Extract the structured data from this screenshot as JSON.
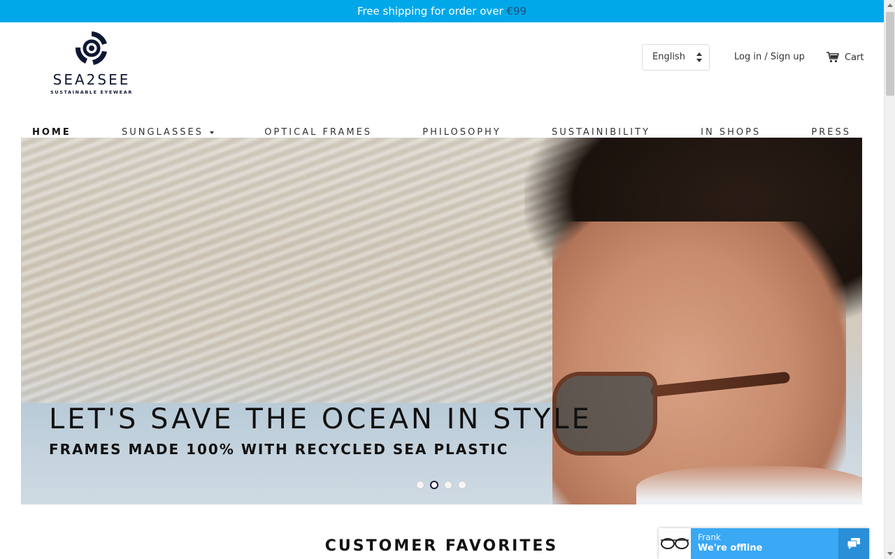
{
  "announcement": {
    "text": "Free shipping for order over ",
    "amount": "€99",
    "background_color": "#00a8ea"
  },
  "header": {
    "logo": {
      "wordmark": "SEA2SEE",
      "tagline": "SUSTAINABLE EYEWEAR",
      "icon": "recycle-swirl-icon"
    },
    "language_select": {
      "selected": "English",
      "icon": "updown-arrows-icon"
    },
    "login_label": "Log in / Sign up",
    "cart": {
      "label": "Cart",
      "icon": "cart-icon"
    }
  },
  "nav": {
    "items": [
      {
        "label": "HOME",
        "active": true
      },
      {
        "label": "SUNGLASSES",
        "has_dropdown": true
      },
      {
        "label": "OPTICAL FRAMES"
      },
      {
        "label": "PHILOSOPHY"
      },
      {
        "label": "SUSTAINIBILITY"
      },
      {
        "label": "IN SHOPS"
      },
      {
        "label": "PRESS"
      }
    ]
  },
  "hero": {
    "title": "LET'S SAVE THE OCEAN IN STYLE",
    "subtitle": "FRAMES MADE 100% WITH RECYCLED SEA PLASTIC",
    "slides_total": 4,
    "active_slide": 2
  },
  "section": {
    "heading": "CUSTOMER FAVORITES"
  },
  "chat": {
    "agent": "Frank",
    "status": "We're offline",
    "icon": "chat-bubbles-icon",
    "avatar_icon": "eyeglasses-icon",
    "color": "#3aa8f5"
  }
}
